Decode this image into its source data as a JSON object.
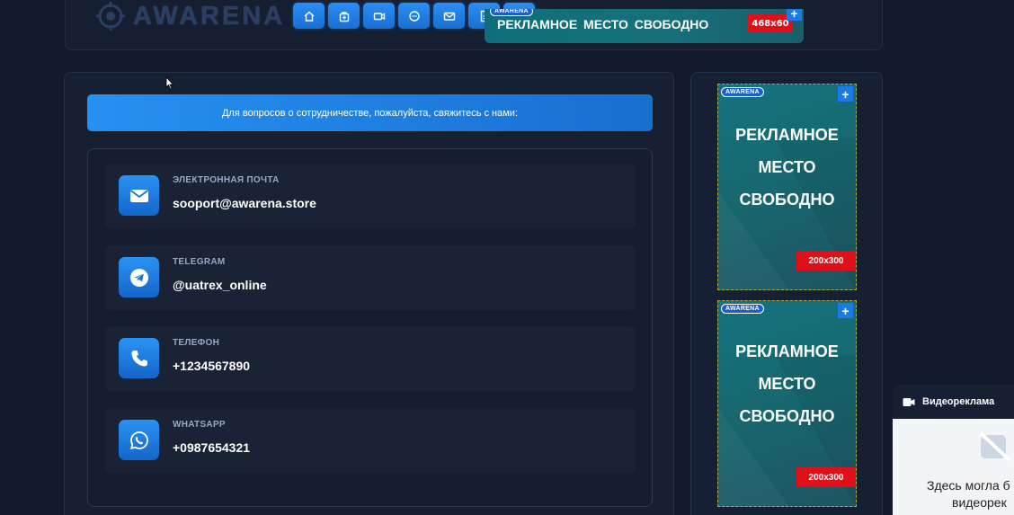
{
  "header": {
    "logo_text": "AWARENA",
    "nav_icons": [
      "home-icon",
      "bag-icon",
      "video-icon",
      "chat-icon",
      "mail-icon",
      "document-icon",
      "shield-icon"
    ],
    "top_ad": {
      "text": "РЕКЛАМНОЕ МЕСТО СВОБОДНО",
      "size": "468x60",
      "badge": "AWARENA",
      "plus": "+"
    }
  },
  "main": {
    "cta_text": "Для вопросов о сотрудничестве, пожалуйста, свяжитесь с нами:",
    "contacts": [
      {
        "label": "ЭЛЕКТРОННАЯ ПОЧТА",
        "value": "sooport@awarena.store",
        "icon": "mail-icon"
      },
      {
        "label": "TELEGRAM",
        "value": "@uatrex_online",
        "icon": "telegram-icon"
      },
      {
        "label": "ТЕЛЕФОН",
        "value": "+1234567890",
        "icon": "phone-icon"
      },
      {
        "label": "WHATSAPP",
        "value": "+0987654321",
        "icon": "whatsapp-icon"
      }
    ]
  },
  "sidebar": {
    "ads": [
      {
        "badge": "AWARENA",
        "plus": "+",
        "line1": "РЕКЛАМНОЕ",
        "line2": "МЕСТО",
        "line3": "СВОБОДНО",
        "size": "200x300"
      },
      {
        "badge": "AWARENA",
        "plus": "+",
        "line1": "РЕКЛАМНОЕ",
        "line2": "МЕСТО",
        "line3": "СВОБОДНО",
        "size": "200x300"
      }
    ]
  },
  "video_widget": {
    "title": "Видеореклама",
    "text_line1": "Здесь могла б",
    "text_line2": "видеорек"
  },
  "colors": {
    "background": "#131a2b",
    "accent": "#1e88f0",
    "ad_teal": "#15737f",
    "size_tag_red": "#e0101b"
  }
}
